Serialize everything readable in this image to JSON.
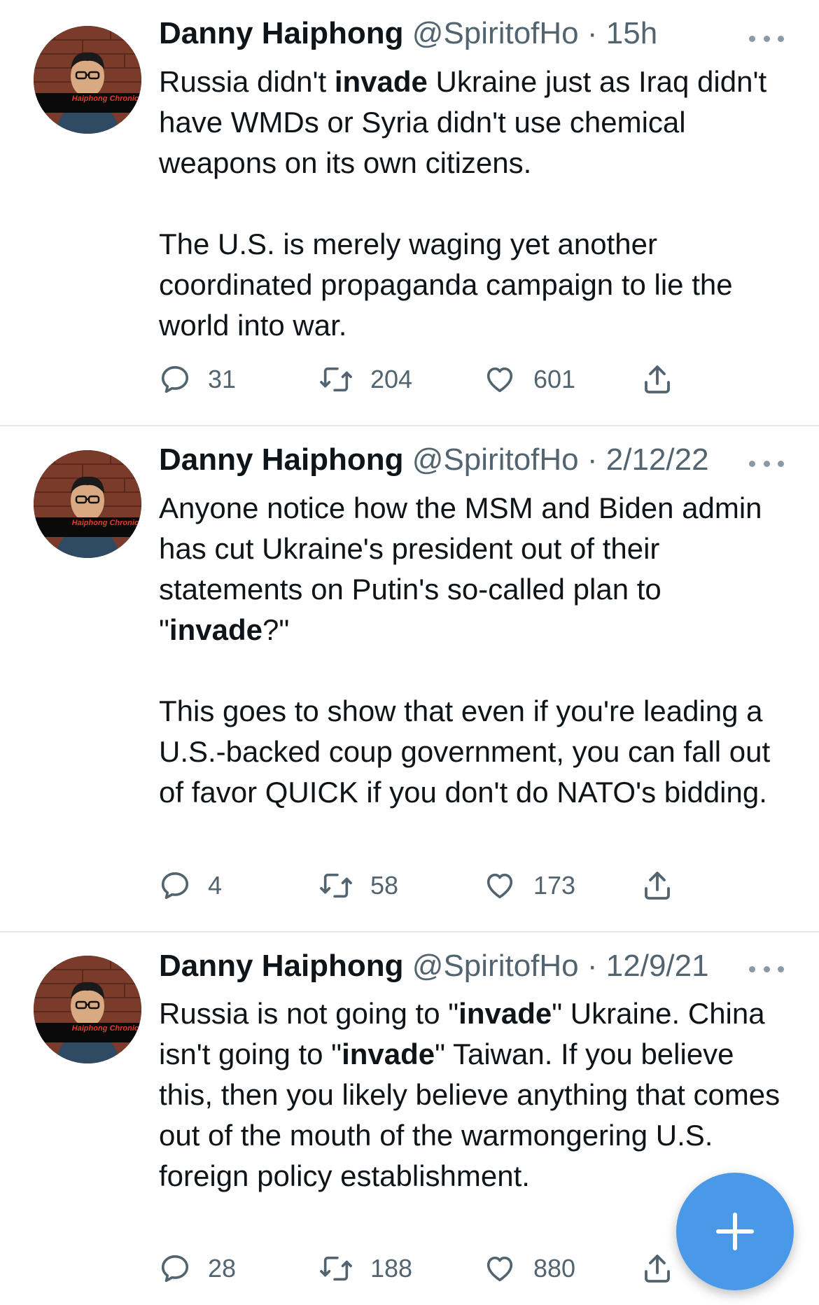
{
  "tweets": [
    {
      "name": "Danny Haiphong",
      "handle": "@SpiritofHo",
      "dot": "·",
      "time": "15h",
      "avatar_caption": "Haiphong Chronic",
      "paragraphs": [
        [
          {
            "t": "Russia didn't "
          },
          {
            "t": "invade",
            "b": true
          },
          {
            "t": " Ukraine just as Iraq didn't have WMDs or Syria didn't use chemical weapons on its own citizens."
          }
        ],
        [
          {
            "t": "The U.S. is merely waging yet another coordinated propaganda campaign to lie the world into war."
          }
        ]
      ],
      "replies": "31",
      "retweets": "204",
      "likes": "601"
    },
    {
      "name": "Danny Haiphong",
      "handle": "@SpiritofHo",
      "dot": "·",
      "time": "2/12/22",
      "avatar_caption": "Haiphong Chronic",
      "paragraphs": [
        [
          {
            "t": "Anyone notice how the MSM and Biden admin has cut Ukraine's president out of their statements on Putin's so-called plan to \""
          },
          {
            "t": "invade",
            "b": true
          },
          {
            "t": "?\""
          }
        ],
        [
          {
            "t": "This goes to show that even if you're leading a U.S.-backed coup government, you can fall out of favor QUICK if you don't do NATO's bidding."
          }
        ]
      ],
      "replies": "4",
      "retweets": "58",
      "likes": "173"
    },
    {
      "name": "Danny Haiphong",
      "handle": "@SpiritofHo",
      "dot": "·",
      "time": "12/9/21",
      "avatar_caption": "Haiphong Chronic",
      "paragraphs": [
        [
          {
            "t": "Russia is not going to \""
          },
          {
            "t": "invade",
            "b": true
          },
          {
            "t": "\" Ukraine. China isn't going to \""
          },
          {
            "t": "invade",
            "b": true
          },
          {
            "t": "\" Taiwan. If you believe this, then you likely believe anything that comes out of the mouth of the warmongering U.S. foreign policy establishment."
          }
        ]
      ],
      "replies": "28",
      "retweets": "188",
      "likes": "880"
    }
  ],
  "icons": {
    "reply": "reply-icon",
    "retweet": "retweet-icon",
    "like": "like-icon",
    "share": "share-icon",
    "more": "more-icon",
    "compose": "plus-icon"
  },
  "colors": {
    "text": "#0f1419",
    "secondary": "#536471",
    "fab": "#4a99e9",
    "divider": "#e6e9ec"
  }
}
